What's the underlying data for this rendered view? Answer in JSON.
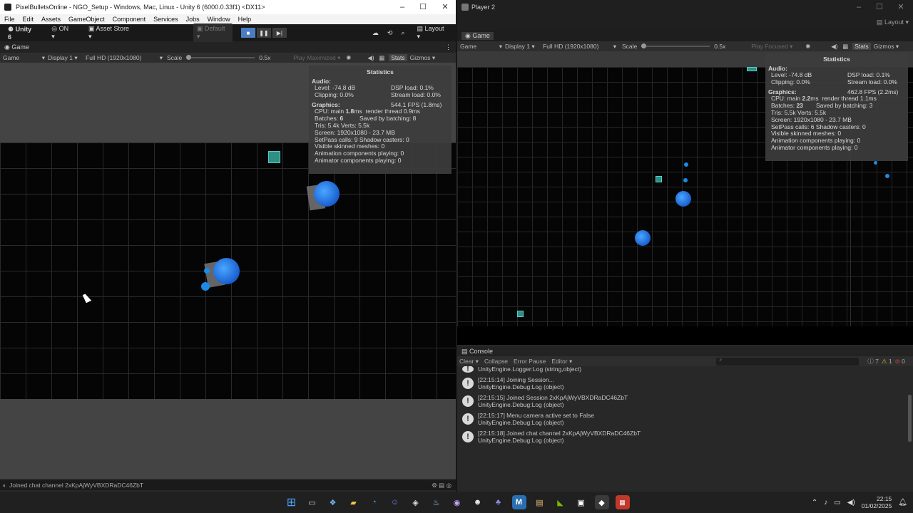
{
  "left_window": {
    "title": "PixelBulletsOnline - NGO_Setup - Windows, Mac, Linux - Unity 6 (6000.0.33f1) <DX11>",
    "menu": [
      "File",
      "Edit",
      "Assets",
      "GameObject",
      "Component",
      "Services",
      "Jobs",
      "Window",
      "Help"
    ],
    "toolbar": {
      "unity_label": "Unity 6",
      "on_label": "ON",
      "asset_store": "Asset Store",
      "default_label": "Default",
      "layout_label": "Layout"
    },
    "tab_label": "Game",
    "gamebar": {
      "mode": "Game",
      "display": "Display 1",
      "resolution": "Full HD (1920x1080)",
      "scale_label": "Scale",
      "scale_value": "0.5x",
      "play_maximized": "Play Maximized",
      "stats": "Stats",
      "gizmos": "Gizmos"
    },
    "stats": {
      "title": "Statistics",
      "audio_header": "Audio:",
      "level": "Level: -74.8 dB",
      "dsp": "DSP load: 0.1%",
      "clipping": "Clipping: 0.0%",
      "stream": "Stream load: 0.0%",
      "graphics_header": "Graphics:",
      "fps": "544.1 FPS (1.8ms)",
      "cpu_prefix": "CPU: main ",
      "cpu_main": "1.8",
      "cpu_suffix": "ms  render thread 0.9ms",
      "batches_prefix": "Batches: ",
      "batches": "6",
      "saved_batching": "Saved by batching: 8",
      "tris": "Tris: 5.4k  Verts: 5.5k",
      "screen": "Screen: 1920x1080 - 23.7 MB",
      "setpass": "SetPass calls: 9  Shadow casters: 0",
      "skinned": "Visible skinned meshes: 0",
      "anim_playing": "Animation components playing: 0",
      "animator_playing": "Animator components playing: 0"
    },
    "status_text": "Joined chat channel 2xKpAjWyVBXDRaDC46ZbT"
  },
  "right_window": {
    "title": "Player 2",
    "layout_label": "Layout",
    "tab_label": "Game",
    "gamebar": {
      "mode": "Game",
      "display": "Display 1",
      "resolution": "Full HD (1920x1080)",
      "scale_label": "Scale",
      "scale_value": "0.5x",
      "play_focused": "Play Focused",
      "stats": "Stats",
      "gizmos": "Gizmos"
    },
    "stats": {
      "title": "Statistics",
      "audio_header": "Audio:",
      "level": "Level: -74.8 dB",
      "dsp": "DSP load: 0.1%",
      "clipping": "Clipping: 0.0%",
      "stream": "Stream load: 0.0%",
      "graphics_header": "Graphics:",
      "fps": "462.8 FPS (2.2ms)",
      "cpu_prefix": "CPU: main ",
      "cpu_main": "2.2",
      "cpu_suffix": "ms  render thread 1.1ms",
      "batches_prefix": "Batches: ",
      "batches": "23",
      "saved_batching": "Saved by batching: 3",
      "tris": "Tris: 5.5k  Verts: 5.5k",
      "screen": "Screen: 1920x1080 - 23.7 MB",
      "setpass": "SetPass calls: 6  Shadow casters: 0",
      "skinned": "Visible skinned meshes: 0",
      "anim_playing": "Animation components playing: 0",
      "animator_playing": "Animator components playing: 0"
    },
    "console": {
      "tab_label": "Console",
      "clear": "Clear",
      "collapse": "Collapse",
      "error_pause": "Error Pause",
      "editor": "Editor",
      "count_logs": "7",
      "count_warnings": "1",
      "count_errors": "0",
      "logs": [
        {
          "line1": "UnityEngine.Logger:Log (string,object)",
          "line2": ""
        },
        {
          "line1": "[22:15:14] Joining Session...",
          "line2": "UnityEngine.Debug:Log (object)"
        },
        {
          "line1": "[22:15:15] Joined Session 2xKpAjWyVBXDRaDC46ZbT",
          "line2": "UnityEngine.Debug:Log (object)"
        },
        {
          "line1": "[22:15:17] Menu camera active set to False",
          "line2": "UnityEngine.Debug:Log (object)"
        },
        {
          "line1": "[22:15:18] Joined chat channel 2xKpAjWyVBXDRaDC46ZbT",
          "line2": "UnityEngine.Debug:Log (object)"
        }
      ]
    }
  },
  "taskbar": {
    "time": "22:15",
    "date": "01/02/2025"
  }
}
